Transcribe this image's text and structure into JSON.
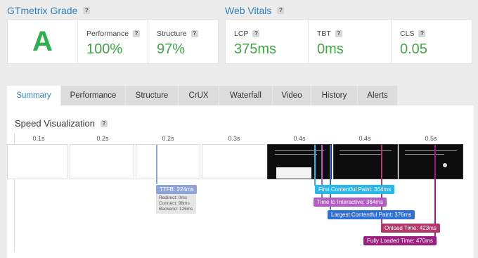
{
  "gtmetrix_grade": {
    "title": "GTmetrix Grade",
    "grade": "A",
    "performance": {
      "label": "Performance",
      "value": "100%"
    },
    "structure": {
      "label": "Structure",
      "value": "97%"
    }
  },
  "web_vitals": {
    "title": "Web Vitals",
    "lcp": {
      "label": "LCP",
      "value": "375ms"
    },
    "tbt": {
      "label": "TBT",
      "value": "0ms"
    },
    "cls": {
      "label": "CLS",
      "value": "0.05"
    }
  },
  "help_badge": "?",
  "tabs": [
    {
      "label": "Summary",
      "active": true
    },
    {
      "label": "Performance"
    },
    {
      "label": "Structure"
    },
    {
      "label": "CrUX"
    },
    {
      "label": "Waterfall"
    },
    {
      "label": "Video"
    },
    {
      "label": "History"
    },
    {
      "label": "Alerts"
    }
  ],
  "speed_visualization": {
    "title": "Speed Visualization",
    "ticks": [
      "0.1s",
      "0.2s",
      "0.2s",
      "0.3s",
      "0.4s",
      "0.4s",
      "0.5s"
    ],
    "ttfb": {
      "label": "TTFB: 224ms",
      "redirect": "Redirect: 0ms",
      "connect": "Connect: 98ms",
      "backend": "Backend: 126ms"
    },
    "markers": [
      {
        "label": "First Contentful Paint: 364ms",
        "color": "#29b6e8"
      },
      {
        "label": "Time to Interactive: 364ms",
        "color": "#b45ec5"
      },
      {
        "label": "Largest Contentful Paint: 376ms",
        "color": "#2f6fd6"
      },
      {
        "label": "Onload Time: 423ms",
        "color": "#b03a6b"
      },
      {
        "label": "Fully Loaded Time: 470ms",
        "color": "#9c1f7f"
      }
    ]
  }
}
